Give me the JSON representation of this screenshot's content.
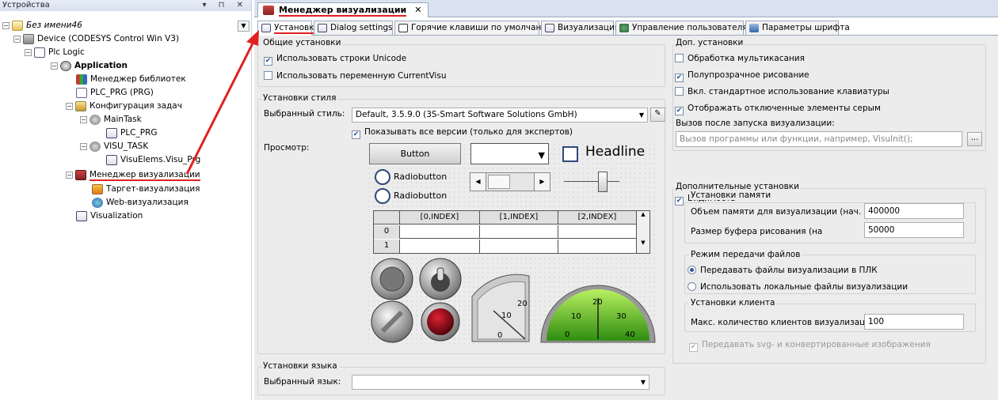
{
  "devices_panel": {
    "title": "Устройства",
    "controls": "▾ ⊓ ✕",
    "tree": [
      {
        "label": "Без имени46",
        "style": "italic"
      },
      {
        "label": "Device (CODESYS Control Win V3)"
      },
      {
        "label": "Plc Logic"
      },
      {
        "label": "Application",
        "style": "bold"
      },
      {
        "label": "Менеджер библиотек"
      },
      {
        "label": "PLC_PRG (PRG)"
      },
      {
        "label": "Конфигурация задач"
      },
      {
        "label": "MainTask"
      },
      {
        "label": "PLC_PRG"
      },
      {
        "label": "VISU_TASK"
      },
      {
        "label": "VisuElems.Visu_Prg"
      },
      {
        "label": "Менеджер визуализации",
        "highlighted": true
      },
      {
        "label": "Таргет-визуализация"
      },
      {
        "label": "Web-визуализация"
      },
      {
        "label": "Visualization"
      }
    ]
  },
  "editor_tab": {
    "label": "Менеджер визуализации",
    "close": "✕"
  },
  "subtabs": [
    {
      "label": "Установки",
      "active": true
    },
    {
      "label": "Dialog settings"
    },
    {
      "label": "Горячие клавиши по умолчанию"
    },
    {
      "label": "Визуализации"
    },
    {
      "label": "Управление пользователями"
    },
    {
      "label": "Параметры шрифта"
    }
  ],
  "general": {
    "title": "Общие установки",
    "unicode": {
      "label": "Использовать строки Unicode",
      "checked": true
    },
    "currentvisu": {
      "label": "Использовать переменную CurrentVisu",
      "checked": false
    }
  },
  "style": {
    "title": "Установки стиля",
    "selected_label": "Выбранный стиль:",
    "selected_value": "Default, 3.5.9.0 (3S-Smart Software Solutions GmbH)",
    "show_all": {
      "label": "Показывать все версии (только для экспертов)",
      "checked": true
    },
    "preview_label": "Просмотр:"
  },
  "preview": {
    "button": "Button",
    "headline": "Headline",
    "radio1": "Radiobutton",
    "radio2": "Radiobutton",
    "table_headers": [
      "[0,INDEX]",
      "[1,INDEX]",
      "[2,INDEX]"
    ],
    "row_indices": [
      "0",
      "1"
    ],
    "gauge1": {
      "ticks": [
        "0",
        "10",
        "20"
      ]
    },
    "gauge2": {
      "ticks": [
        "0",
        "10",
        "20",
        "30",
        "40"
      ]
    }
  },
  "language": {
    "title": "Установки языка",
    "selected_label": "Выбранный язык:",
    "selected_value": ""
  },
  "extra": {
    "title": "Доп. установки",
    "multitouch": {
      "label": "Обработка мультикасания",
      "checked": false
    },
    "semitransparent": {
      "label": "Полупрозрачное рисование",
      "checked": true
    },
    "keyboard": {
      "label": "Вкл. стандартное использование клавиатуры",
      "checked": false
    },
    "disabled_gray": {
      "label": "Отображать отключенные элементы серым",
      "checked": true
    },
    "call_after_label": "Вызов после запуска визуализации:",
    "call_after_placeholder": "Вызов программы или функции, например, VisuInit();",
    "browse": "..."
  },
  "additional": {
    "title": "Дополнительные установки",
    "visibility": {
      "label": "Видимость",
      "checked": true
    },
    "memory": {
      "title": "Установки памяти",
      "size_label": "Объем памяти для визуализации (нач. значе",
      "size_value": "400000",
      "buffer_label": "Размер буфера рисования (на",
      "buffer_value": "50000"
    },
    "file_transfer": {
      "title": "Режим передачи файлов",
      "opt1": {
        "label": "Передавать файлы визуализации в ПЛК",
        "selected": true
      },
      "opt2": {
        "label": "Использовать локальные файлы визуализации",
        "selected": false
      }
    },
    "client": {
      "title": "Установки клиента",
      "max_label": "Макс. количество клиентов визуализации:",
      "max_value": "100"
    },
    "svg": {
      "label": "Передавать svg- и конвертированные изображения",
      "checked": true,
      "disabled": true
    }
  },
  "colors": {
    "arrow": "#e02020",
    "underline": "#e02020",
    "accent": "#2a5aa8"
  }
}
